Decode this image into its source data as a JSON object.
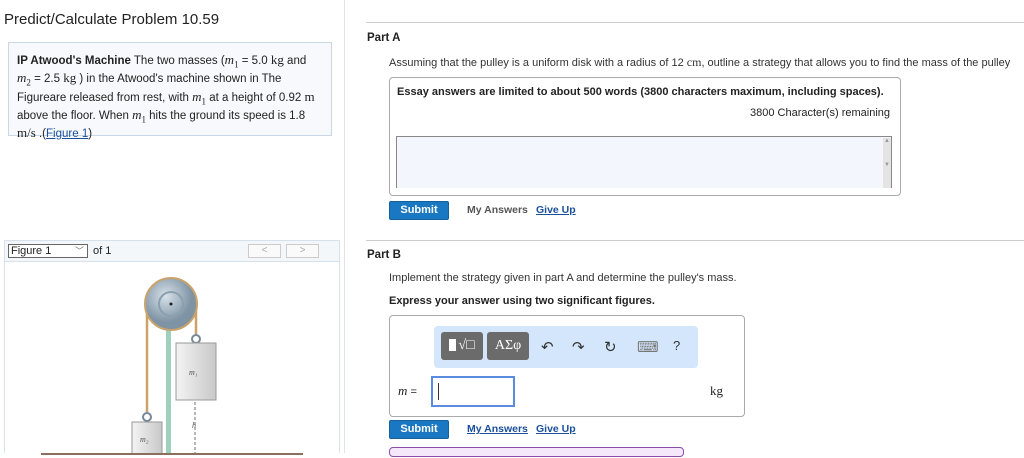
{
  "title": "Predict/Calculate Problem 10.59",
  "problem": {
    "heading": "IP Atwood's Machine",
    "t1": " The two masses (",
    "m1": "m",
    "sub1": "1",
    "t2": " = 5.0 ",
    "kg": "kg",
    "t3": " and ",
    "m2": "m",
    "sub2": "2",
    "t4": " = 2.5 ",
    "t5": " ) in the Atwood's machine shown in The Figureare released from rest, with ",
    "t6": " at a height of 0.92 ",
    "m_unit": "m",
    "t7": " above the floor. When ",
    "t8": " hits the ground its speed is 1.8 ",
    "speed_unit": "m/s",
    "t9": " .(",
    "figure_link": "Figure 1",
    "t10": ")"
  },
  "figure": {
    "selected": "Figure 1",
    "of": "of 1",
    "prev": "<",
    "next": ">",
    "label_m1": "m",
    "label_m1_sub": "1",
    "label_m2": "m",
    "label_m2_sub": "2",
    "label_h": "h"
  },
  "partA": {
    "label": "Part A",
    "question_pre": "Assuming that the pulley is a uniform disk with a radius of 12 ",
    "question_unit": "cm",
    "question_post": ", outline a strategy that allows you to find the mass of the pulley",
    "essay_limit": "Essay answers are limited to about 500 words (3800 characters maximum, including spaces).",
    "remaining": "3800 Character(s) remaining",
    "submit": "Submit",
    "my_answers": "My Answers",
    "give_up": "Give Up"
  },
  "partB": {
    "label": "Part B",
    "question": "Implement the strategy given in part A and determine the pulley's mass.",
    "instruction": "Express your answer using two significant figures.",
    "templates_btn": "√□",
    "greek_btn": "ΑΣφ",
    "undo": "↶",
    "redo": "↷",
    "reset": "↻",
    "keyboard": "⌨",
    "help": "?",
    "var": "m",
    "eq": " =",
    "unit": "kg",
    "submit": "Submit",
    "my_answers": "My Answers",
    "give_up": "Give Up"
  }
}
